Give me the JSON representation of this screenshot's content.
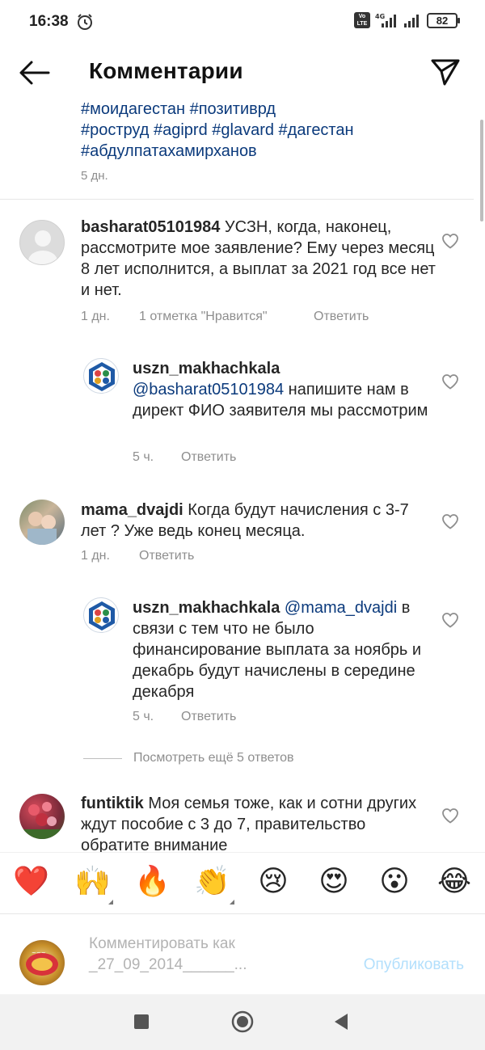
{
  "status_bar": {
    "time": "16:38",
    "battery": "82",
    "network": "4G",
    "volte": "Vo LTE"
  },
  "header": {
    "title": "Комментарии"
  },
  "caption": {
    "lines": [
      "#моидагестан #позитиврд",
      "#роструд #agiprd #glavard #дагестан",
      "#абдулпатахамирханов"
    ],
    "time": "5 дн."
  },
  "comments": [
    {
      "username": "basharat05101984",
      "text": " УСЗН, когда, наконец, рассмотрите мое заявление? Ему через месяц 8 лет исполнится, а выплат за 2021 год все нет и нет.",
      "time": "1 дн.",
      "likes": "1 отметка \"Нравится\"",
      "reply_label": "Ответить"
    },
    {
      "username": "uszn_makhachkala",
      "mention": "@basharat05101984",
      "text": " напишите нам в директ ФИО заявителя мы рассмотрим",
      "time": "5 ч.",
      "reply_label": "Ответить"
    },
    {
      "username": "mama_dvajdi",
      "text": " Когда будут начисления с 3-7 лет ? Уже ведь конец месяца.",
      "time": "1 дн.",
      "reply_label": "Ответить"
    },
    {
      "username": "uszn_makhachkala",
      "mention": "@mama_dvajdi",
      "text": " в связи с тем что не было финансирование выплата за ноябрь и декабрь будут начислены в середине декабря",
      "time": "5 ч.",
      "reply_label": "Ответить"
    },
    {
      "username": "funtiktik",
      "text": " Моя семья тоже, как и сотни других ждут пособие с 3 до 7, правительство обратите внимание"
    }
  ],
  "more_replies": "Посмотреть ещё 5 ответов",
  "emoji_bar": {
    "items": [
      {
        "name": "red-heart",
        "glyph": "❤️"
      },
      {
        "name": "raising-hands",
        "glyph": "🙌"
      },
      {
        "name": "fire",
        "glyph": "🔥"
      },
      {
        "name": "clapping-hands",
        "glyph": "👏"
      },
      {
        "name": "crying-face",
        "glyph": "😢"
      },
      {
        "name": "heart-eyes",
        "glyph": "😍"
      },
      {
        "name": "astonished-face",
        "glyph": "😮"
      },
      {
        "name": "tears-of-joy",
        "glyph": "😂"
      }
    ]
  },
  "compose": {
    "placeholder_line1": "Комментировать как",
    "placeholder_line2": "_27_09_2014______...",
    "publish_label": "Опубликовать"
  },
  "colors": {
    "link": "#0b3a7c",
    "meta": "#8e8e8e",
    "publish_disabled": "#b2dffc"
  }
}
